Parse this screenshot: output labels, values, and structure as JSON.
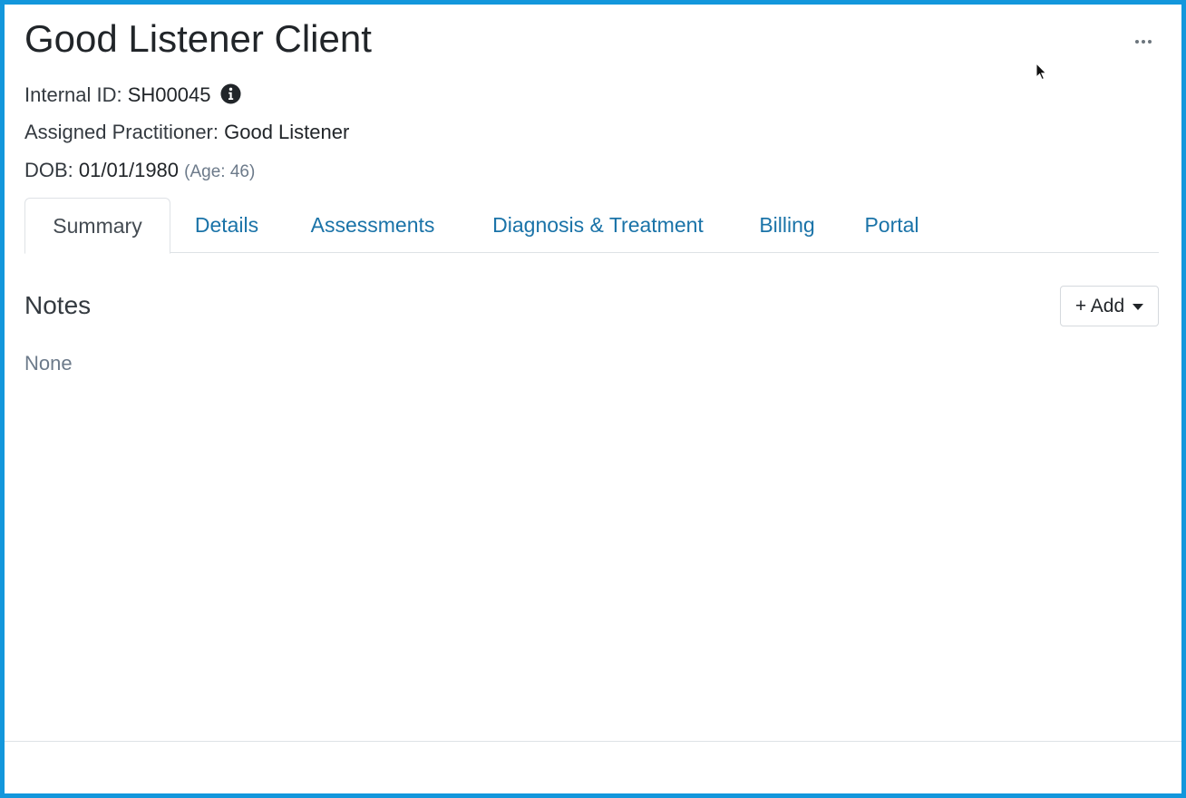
{
  "client": {
    "name": "Good Listener Client"
  },
  "header": {
    "internal_id_label": "Internal ID:",
    "internal_id_value": "SH00045",
    "practitioner_label": "Assigned Practitioner:",
    "practitioner_value": "Good Listener",
    "dob_label": "DOB:",
    "dob_value": "01/01/1980",
    "age_text": "(Age: 46)",
    "more_icon": "ellipsis-icon",
    "info_icon": "info-circle-icon"
  },
  "tabs": [
    {
      "label": "Summary",
      "active": true
    },
    {
      "label": "Details",
      "active": false
    },
    {
      "label": "Assessments",
      "active": false
    },
    {
      "label": "Diagnosis & Treatment",
      "active": false
    },
    {
      "label": "Billing",
      "active": false
    },
    {
      "label": "Portal",
      "active": false
    }
  ],
  "notes": {
    "title": "Notes",
    "add_label": "+ Add",
    "empty_text": "None"
  },
  "colors": {
    "frame_border": "#1397dc",
    "link": "#1a73a8",
    "muted": "#6c7a8a"
  }
}
